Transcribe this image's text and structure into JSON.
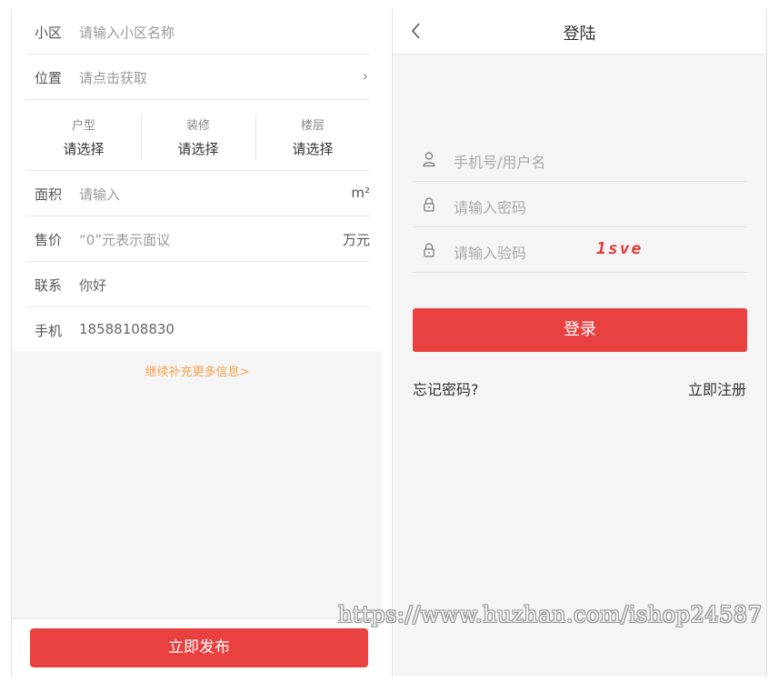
{
  "publish_form": {
    "rows": [
      {
        "label": "小区",
        "value": "请输入小区名称"
      },
      {
        "label": "位置",
        "value": "请点击获取",
        "chevron": "›"
      },
      {
        "label": "面积",
        "value": "请输入",
        "unit": "m²"
      },
      {
        "label": "售价",
        "value": "“0”元表示面议",
        "unit": "万元"
      },
      {
        "label": "联系",
        "value": "你好"
      },
      {
        "label": "手机",
        "value": "18588108830"
      }
    ],
    "selectors": [
      {
        "title": "户型",
        "value": "请选择"
      },
      {
        "title": "装修",
        "value": "请选择"
      },
      {
        "title": "楼层",
        "value": "请选择"
      }
    ],
    "more_link": "继续补充更多信息>",
    "submit_label": "立即发布"
  },
  "login": {
    "title": "登陆",
    "back_icon": "chevron-left-icon",
    "username_placeholder": "手机号/用户名",
    "password_placeholder": "请输入密码",
    "captcha_placeholder": "请输入验码",
    "captcha_text": "1sve",
    "login_label": "登录",
    "forgot_label": "忘记密码?",
    "register_label": "立即注册"
  },
  "watermark": "https://www.huzhan.com/ishop24587",
  "colors": {
    "accent": "#e94040",
    "link_orange": "#f6a04d",
    "captcha_red": "#e23a3a"
  }
}
